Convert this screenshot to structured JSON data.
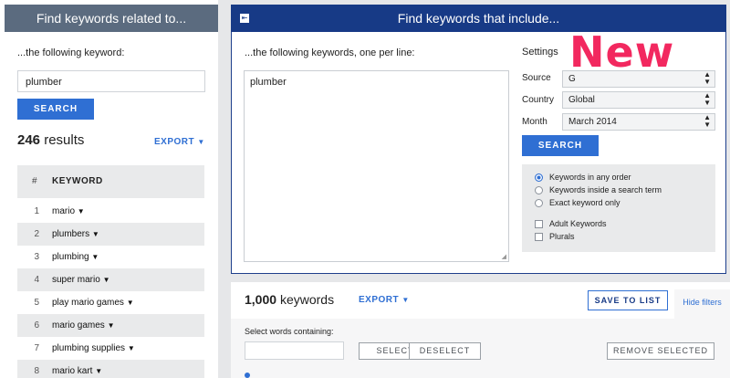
{
  "left": {
    "header": "Find keywords related to...",
    "prompt": "...the following keyword:",
    "input_value": "plumber",
    "search_label": "SEARCH",
    "results_count": "246",
    "results_word": "results",
    "export_label": "EXPORT",
    "col_num": "#",
    "col_keyword": "KEYWORD",
    "rows": [
      {
        "n": "1",
        "k": "mario"
      },
      {
        "n": "2",
        "k": "plumbers"
      },
      {
        "n": "3",
        "k": "plumbing"
      },
      {
        "n": "4",
        "k": "super mario"
      },
      {
        "n": "5",
        "k": "play mario games"
      },
      {
        "n": "6",
        "k": "mario games"
      },
      {
        "n": "7",
        "k": "plumbing supplies"
      },
      {
        "n": "8",
        "k": "mario kart"
      }
    ]
  },
  "right": {
    "header": "Find keywords that include...",
    "prompt": "...the following keywords, one per line:",
    "textarea_value": "plumber",
    "settings_title": "Settings",
    "source_label": "Source",
    "source_value": "G",
    "country_label": "Country",
    "country_value": "Global",
    "month_label": "Month",
    "month_value": "March 2014",
    "search_label": "SEARCH",
    "options": [
      "Keywords in any order",
      "Keywords inside a search term",
      "Exact keyword only"
    ],
    "checks": [
      "Adult Keywords",
      "Plurals"
    ],
    "new_badge": "New",
    "count": "1,000",
    "count_word": "keywords",
    "export_label": "EXPORT",
    "save_to_list": "SAVE TO LIST",
    "hide_filters": "Hide filters",
    "filter_label": "Select words containing:",
    "select_label": "SELECT",
    "deselect_label": "DESELECT",
    "remove_selected": "REMOVE SELECTED"
  },
  "colors": {
    "accent": "#2f6fd3",
    "header_dark": "#173a86",
    "header_gray": "#5b6b7f",
    "new": "#f2285f"
  }
}
